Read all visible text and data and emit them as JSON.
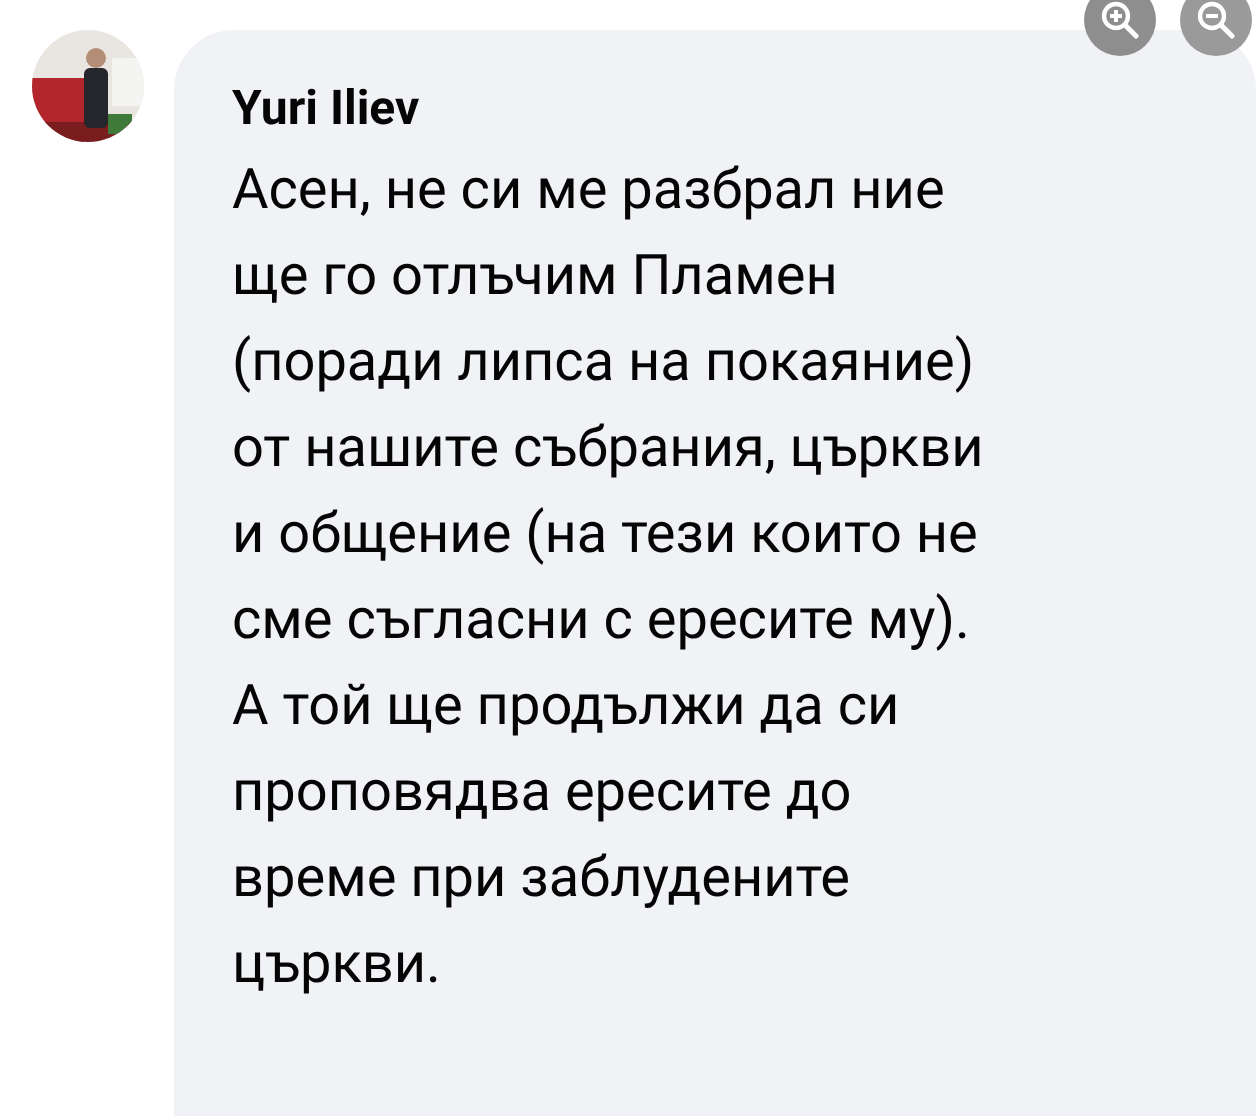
{
  "viewer_controls": [
    {
      "kind": "zoom-in"
    },
    {
      "kind": "zoom-out"
    }
  ],
  "comment": {
    "author": "Yuri Iliev",
    "lines": [
      "Асен, не си ме разбрал ние",
      "ще го отлъчим Пламен",
      "(поради липса на покаяние)",
      "от нашите събрания, църкви",
      "и общение (на тези които не",
      "сме съгласни с ересите му).",
      "А той ще продължи да си",
      "проповядва ересите до",
      "време при заблудените",
      "църкви."
    ]
  }
}
